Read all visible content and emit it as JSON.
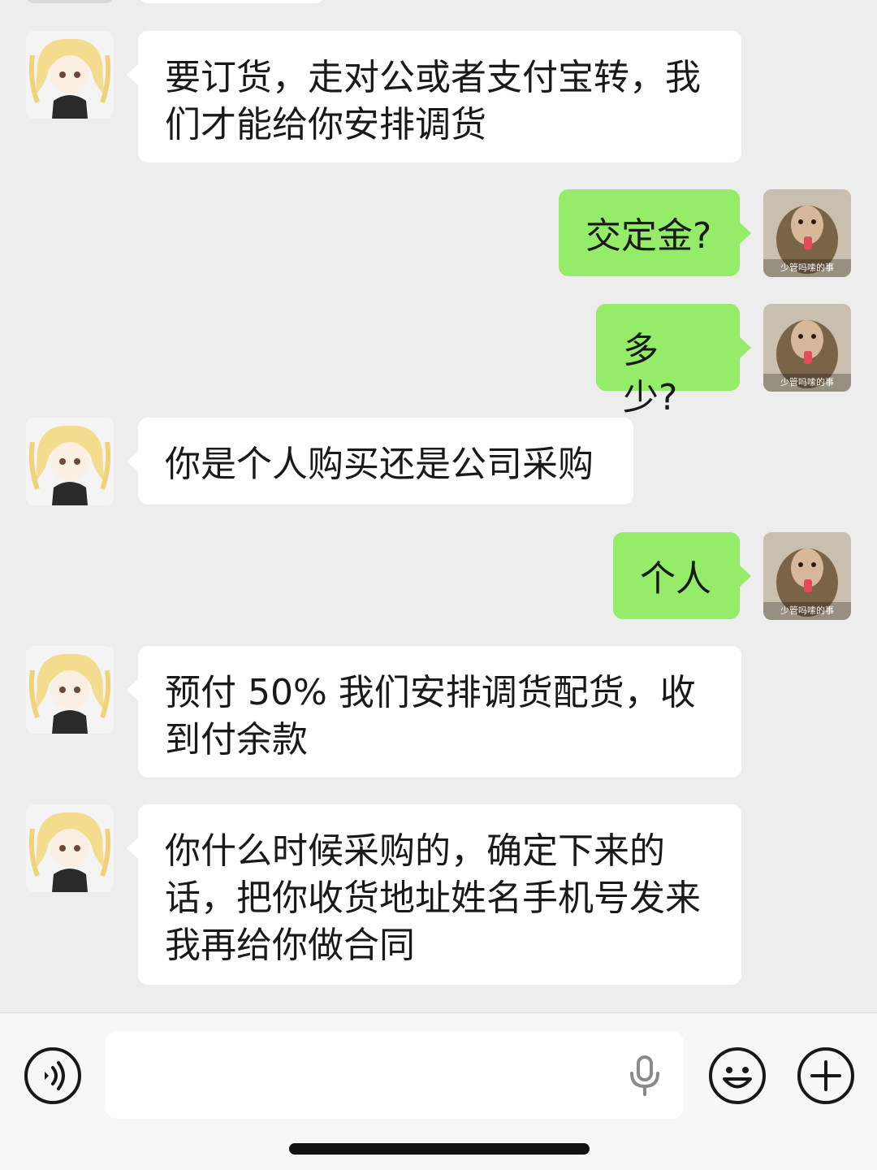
{
  "chat": {
    "messages": [
      {
        "side": "incoming",
        "text": "要订货，走对公或者支付宝转，我们才能给你安排调货"
      },
      {
        "side": "outgoing",
        "text": "交定金?"
      },
      {
        "side": "outgoing",
        "text": "多少?"
      },
      {
        "side": "incoming",
        "text": "你是个人购买还是公司采购"
      },
      {
        "side": "outgoing",
        "text": "个人"
      },
      {
        "side": "incoming",
        "text": "预付 50% 我们安排调货配货，收到付余款"
      },
      {
        "side": "incoming",
        "text": "你什么时候采购的，确定下来的话，把你收货地址姓名手机号发来我再给你做合同"
      }
    ],
    "my_avatar_caption": "少管吗嗦的事"
  },
  "input_bar": {
    "text_value": "",
    "icons": [
      "voice-toggle-icon",
      "microphone-icon",
      "emoji-icon",
      "plus-icon"
    ]
  },
  "colors": {
    "outgoing_bubble": "#95ec69",
    "incoming_bubble": "#ffffff",
    "background": "#ededed"
  }
}
